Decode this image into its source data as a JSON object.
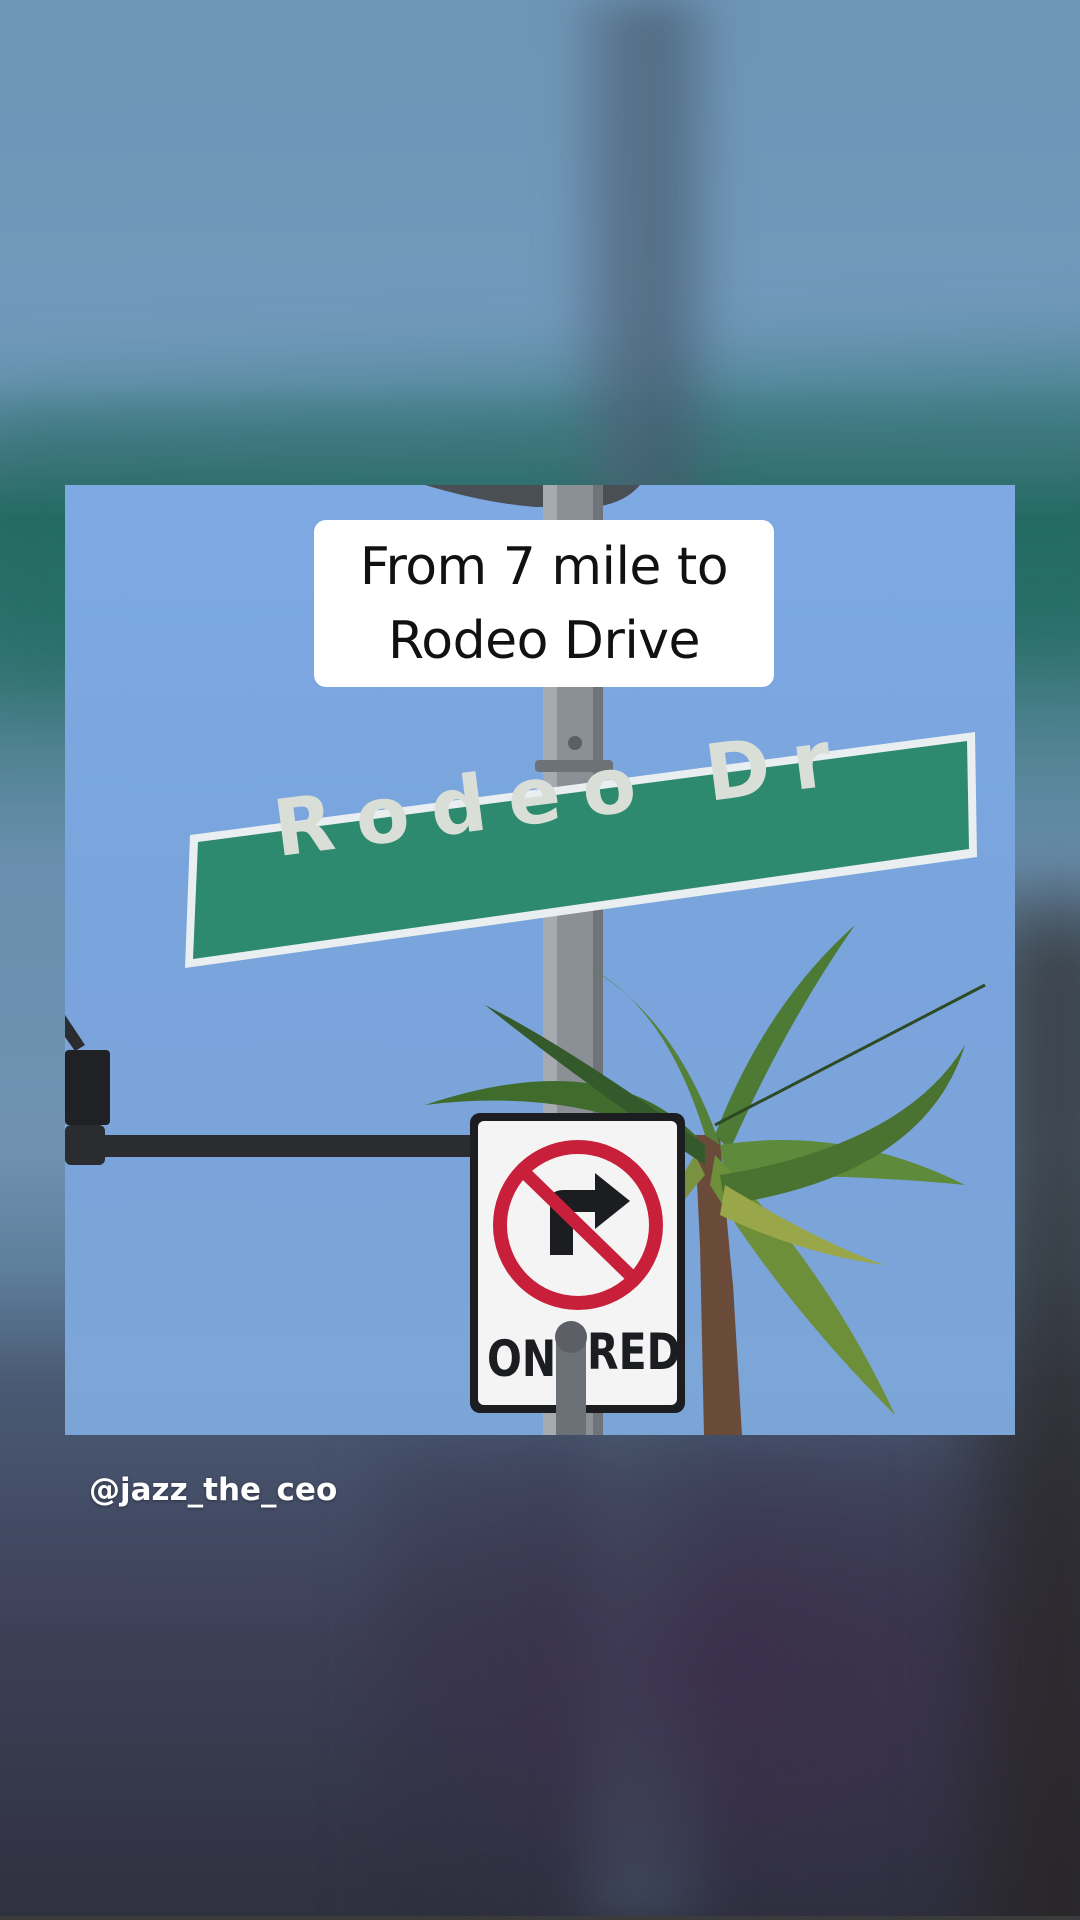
{
  "video": {
    "caption": "From 7 mile to Rodeo Drive",
    "street_sign_text": "Rodeo Dr",
    "regulatory_sign": {
      "symbol": "no-right-turn-icon",
      "text_left": "ON",
      "text_right": "RED"
    }
  },
  "author": {
    "username": "@jazz_the_ceo"
  },
  "colors": {
    "street_sign_green": "#2e8a6e",
    "no_turn_red": "#c8203a",
    "caption_bg": "#ffffff"
  }
}
